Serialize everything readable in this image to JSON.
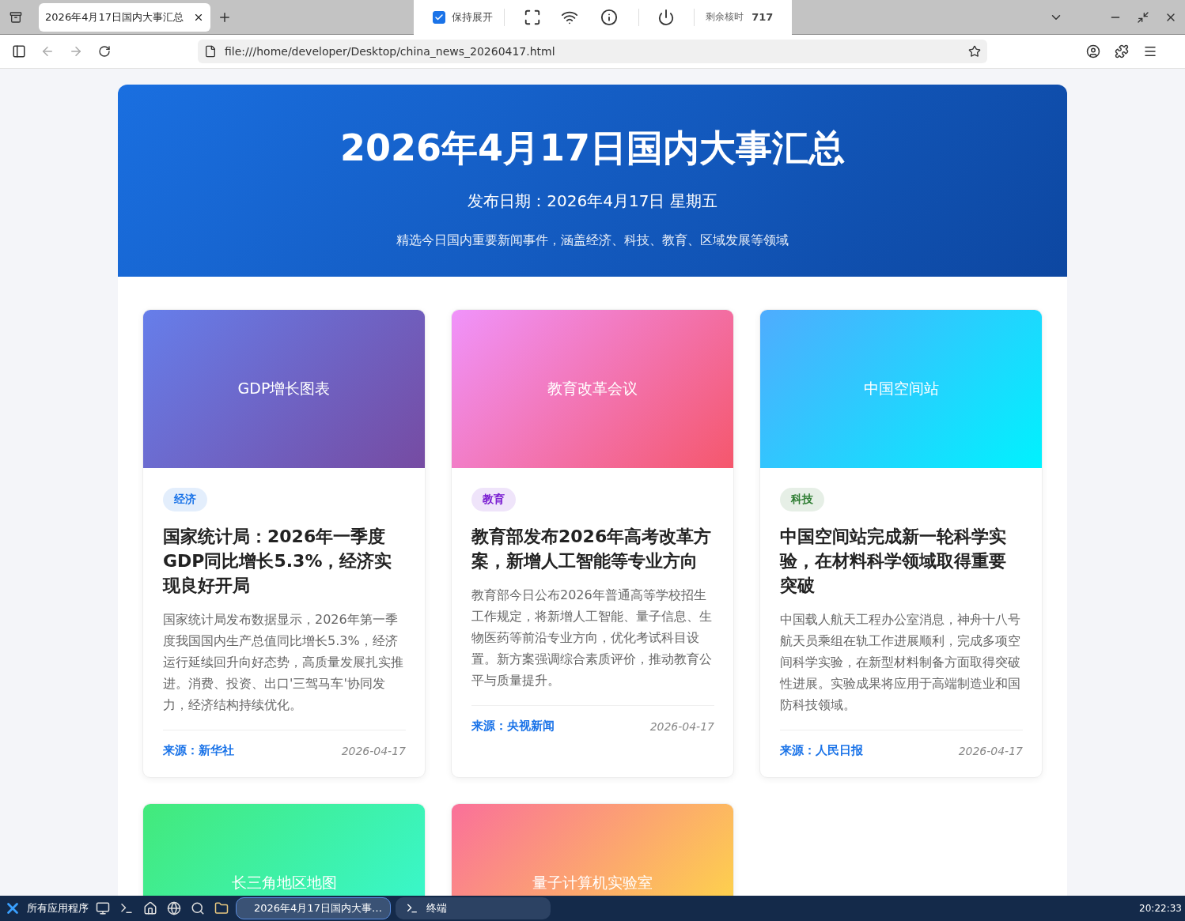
{
  "browser": {
    "tab": {
      "title": "2026年4月17日国内大事汇总",
      "selected": true
    },
    "overlay": {
      "keep_expanded": {
        "label": "保持展开",
        "checked": true
      },
      "remaining": {
        "label": "剩余核时",
        "value": "717"
      }
    },
    "url": "file:///home/developer/Desktop/china_news_20260417.html"
  },
  "header": {
    "title": "2026年4月17日国内大事汇总",
    "date": "发布日期：2026年4月17日 星期五",
    "subtitle": "精选今日国内重要新闻事件，涵盖经济、科技、教育、区域发展等领域"
  },
  "cards": [
    {
      "image_label": "GDP增长图表",
      "tag": {
        "label": "经济",
        "color": "#1a73e8"
      },
      "title": "国家统计局：2026年一季度GDP同比增长5.3%，经济实现良好开局",
      "summary": "国家统计局发布数据显示，2026年第一季度我国国内生产总值同比增长5.3%，经济运行延续回升向好态势，高质量发展扎实推进。消费、投资、出口'三驾马车'协同发力，经济结构持续优化。",
      "source": "来源：新华社",
      "date": "2026-04-17"
    },
    {
      "image_label": "教育改革会议",
      "tag": {
        "label": "教育",
        "color": "#7b1fd2"
      },
      "title": "教育部发布2026年高考改革方案，新增人工智能等专业方向",
      "summary": "教育部今日公布2026年普通高等学校招生工作规定，将新增人工智能、量子信息、生物医药等前沿专业方向，优化考试科目设置。新方案强调综合素质评价，推动教育公平与质量提升。",
      "source": "来源：央视新闻",
      "date": "2026-04-17"
    },
    {
      "image_label": "中国空间站",
      "tag": {
        "label": "科技",
        "color": "#2e7d32"
      },
      "title": "中国空间站完成新一轮科学实验，在材料科学领域取得重要突破",
      "summary": "中国载人航天工程办公室消息，神舟十八号航天员乘组在轨工作进展顺利，完成多项空间科学实验，在新型材料制备方面取得突破性进展。实验成果将应用于高端制造业和国防科技领域。",
      "source": "来源：人民日报",
      "date": "2026-04-17"
    },
    {
      "image_label": "长三角地区地图"
    },
    {
      "image_label": "量子计算机实验室"
    }
  ],
  "taskbar": {
    "start_label": "所有应用程序",
    "tasks": [
      {
        "label": "2026年4月17日国内大事…",
        "kind": "browser",
        "selected": true
      },
      {
        "label": "终端",
        "kind": "terminal",
        "selected": false
      }
    ],
    "clock": "20:22:33"
  }
}
